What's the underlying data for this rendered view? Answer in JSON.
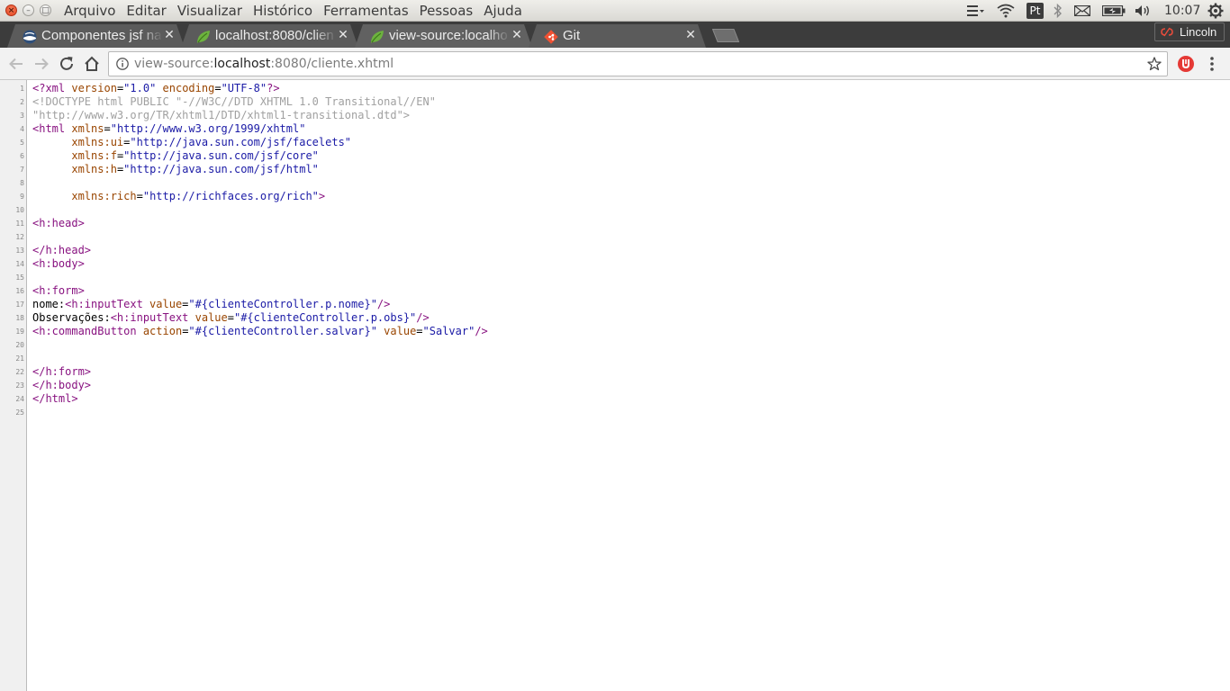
{
  "menubar": {
    "items": [
      "Arquivo",
      "Editar",
      "Visualizar",
      "Histórico",
      "Ferramentas",
      "Pessoas",
      "Ajuda"
    ],
    "indicator_pt": "Pt",
    "clock": "10:07"
  },
  "tabs": [
    {
      "title": "Componentes jsf na",
      "icon": "jsf-globe-icon"
    },
    {
      "title": "localhost:8080/clien",
      "icon": "spring-leaf-icon"
    },
    {
      "title": "view-source:localho",
      "icon": "spring-leaf-icon",
      "active": true
    },
    {
      "title": "Git",
      "icon": "git-icon"
    }
  ],
  "profile": {
    "name": "Lincoln"
  },
  "omnibox": {
    "scheme": "view-source:",
    "host": "localhost",
    "path": ":8080/cliente.xhtml"
  },
  "source": {
    "line_numbers": [
      "1",
      "2",
      "3",
      "4",
      "5",
      "6",
      "7",
      "8",
      "9",
      "10",
      "11",
      "12",
      "13",
      "14",
      "15",
      "16",
      "17",
      "18",
      "19",
      "20",
      "21",
      "22",
      "23",
      "24",
      "25"
    ],
    "l1": {
      "open": "<?xml ",
      "a1": "version",
      "eq1": "=",
      "v1": "\"1.0\"",
      "sp": " ",
      "a2": "encoding",
      "eq2": "=",
      "v2": "\"UTF-8\"",
      "close": "?>"
    },
    "l2": "<!DOCTYPE html PUBLIC \"-//W3C//DTD XHTML 1.0 Transitional//EN\"",
    "l3": "\"http://www.w3.org/TR/xhtml1/DTD/xhtml1-transitional.dtd\">",
    "l4": {
      "tag": "<html ",
      "attr": "xmlns",
      "eq": "=",
      "val": "\"http://www.w3.org/1999/xhtml\""
    },
    "l5": {
      "indent": "      ",
      "attr": "xmlns:ui",
      "eq": "=",
      "val": "\"http://java.sun.com/jsf/facelets\""
    },
    "l6": {
      "indent": "      ",
      "attr": "xmlns:f",
      "eq": "=",
      "val": "\"http://java.sun.com/jsf/core\""
    },
    "l7": {
      "indent": "      ",
      "attr": "xmlns:h",
      "eq": "=",
      "val": "\"http://java.sun.com/jsf/html\""
    },
    "l9": {
      "indent": "      ",
      "attr": "xmlns:rich",
      "eq": "=",
      "val": "\"http://richfaces.org/rich\"",
      "close": ">"
    },
    "l11": "<h:head>",
    "l13": "</h:head>",
    "l14": "<h:body>",
    "l16": "<h:form>",
    "l17": {
      "text": "nome:",
      "tag": "<h:inputText ",
      "attr": "value",
      "eq": "=",
      "val": "\"#{clienteController.p.nome}\"",
      "close": "/>"
    },
    "l18": {
      "text": "Observações:",
      "tag": "<h:inputText ",
      "attr": "value",
      "eq": "=",
      "val": "\"#{clienteController.p.obs}\"",
      "close": "/>"
    },
    "l19": {
      "tag": "<h:commandButton ",
      "attr1": "action",
      "eq1": "=",
      "val1": "\"#{clienteController.salvar}\"",
      "sp": " ",
      "attr2": "value",
      "eq2": "=",
      "val2": "\"Salvar\"",
      "close": "/>"
    },
    "l22": "</h:form>",
    "l23": "</h:body>",
    "l24": "</html>"
  },
  "colors": {
    "tag": "#881280",
    "attribute": "#994500",
    "value": "#1a1aa6",
    "doctype": "#a0a0a0",
    "tabstrip": "#3c3c3c",
    "close_button": "#e2411f"
  }
}
